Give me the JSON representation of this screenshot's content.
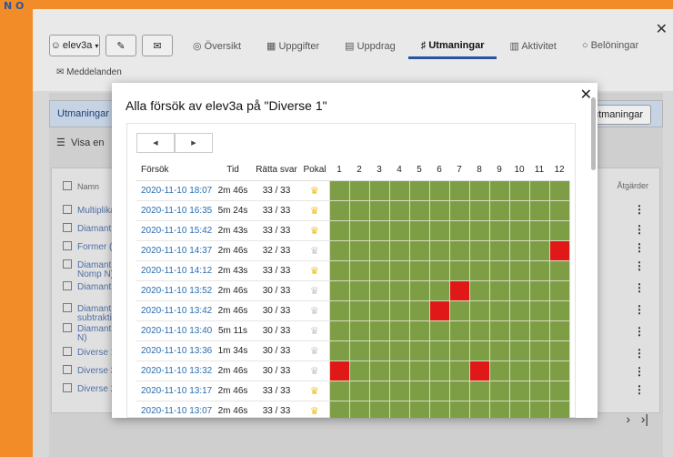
{
  "logo": {
    "text": "N O"
  },
  "topbar": {
    "user_label": "elev3a",
    "tabs": [
      {
        "label": "Översikt",
        "icon": "eye-icon"
      },
      {
        "label": "Uppgifter",
        "icon": "grid-icon"
      },
      {
        "label": "Uppdrag",
        "icon": "document-icon"
      },
      {
        "label": "Utmaningar",
        "icon": "trophy-icon",
        "active": true
      },
      {
        "label": "Aktivitet",
        "icon": "bar-chart-icon"
      },
      {
        "label": "Belöningar",
        "icon": "circle-icon"
      }
    ],
    "messages_label": "Meddelanden"
  },
  "background": {
    "section_title": "Utmaningar",
    "right_button": "utmaningar",
    "filter_label": "Visa en",
    "col_name": "Namn",
    "col_actions": "Åtgärder",
    "items": [
      "Multiplika",
      "Diamant: l",
      "Former (s",
      "Diamant: N",
      "Nomp N)",
      "Diamant: N)",
      "Diamant: A",
      "subtrakti",
      "Diamant: A",
      "N)",
      "Diverse 1",
      "Diverse 3",
      "Diverse 2"
    ]
  },
  "modal": {
    "title": "Alla försök av elev3a på \"Diverse 1\"",
    "columns": {
      "attempt": "Försök",
      "time": "Tid",
      "correct": "Rätta svar",
      "trophy": "Pokal",
      "numbers": [
        "1",
        "2",
        "3",
        "4",
        "5",
        "6",
        "7",
        "8",
        "9",
        "10",
        "11",
        "12"
      ]
    },
    "rows": [
      {
        "date": "2020-11-10 18:07",
        "time": "2m 46s",
        "correct": "33 / 33",
        "trophy": "gold",
        "wrong": []
      },
      {
        "date": "2020-11-10 16:35",
        "time": "5m 24s",
        "correct": "33 / 33",
        "trophy": "gold",
        "wrong": []
      },
      {
        "date": "2020-11-10 15:42",
        "time": "2m 43s",
        "correct": "33 / 33",
        "trophy": "gold",
        "wrong": []
      },
      {
        "date": "2020-11-10 14:37",
        "time": "2m 46s",
        "correct": "32 / 33",
        "trophy": "gray",
        "wrong": [
          12
        ]
      },
      {
        "date": "2020-11-10 14:12",
        "time": "2m 43s",
        "correct": "33 / 33",
        "trophy": "gold",
        "wrong": []
      },
      {
        "date": "2020-11-10 13:52",
        "time": "2m 46s",
        "correct": "30 / 33",
        "trophy": "gray",
        "wrong": [
          7
        ]
      },
      {
        "date": "2020-11-10 13:42",
        "time": "2m 46s",
        "correct": "30 / 33",
        "trophy": "gray",
        "wrong": [
          6
        ]
      },
      {
        "date": "2020-11-10 13:40",
        "time": "5m 11s",
        "correct": "30 / 33",
        "trophy": "gray",
        "wrong": []
      },
      {
        "date": "2020-11-10 13:36",
        "time": "1m 34s",
        "correct": "30 / 33",
        "trophy": "gray",
        "wrong": []
      },
      {
        "date": "2020-11-10 13:32",
        "time": "2m 46s",
        "correct": "30 / 33",
        "trophy": "gray",
        "wrong": [
          1,
          8
        ]
      },
      {
        "date": "2020-11-10 13:17",
        "time": "2m 46s",
        "correct": "33 / 33",
        "trophy": "gold",
        "wrong": []
      },
      {
        "date": "2020-11-10 13:07",
        "time": "2m 46s",
        "correct": "33 / 33",
        "trophy": "gold",
        "wrong": []
      }
    ]
  },
  "colors": {
    "correct": "#7e9e45",
    "wrong": "#e01818",
    "accent": "#2a55a0",
    "frame": "#f28c28"
  }
}
